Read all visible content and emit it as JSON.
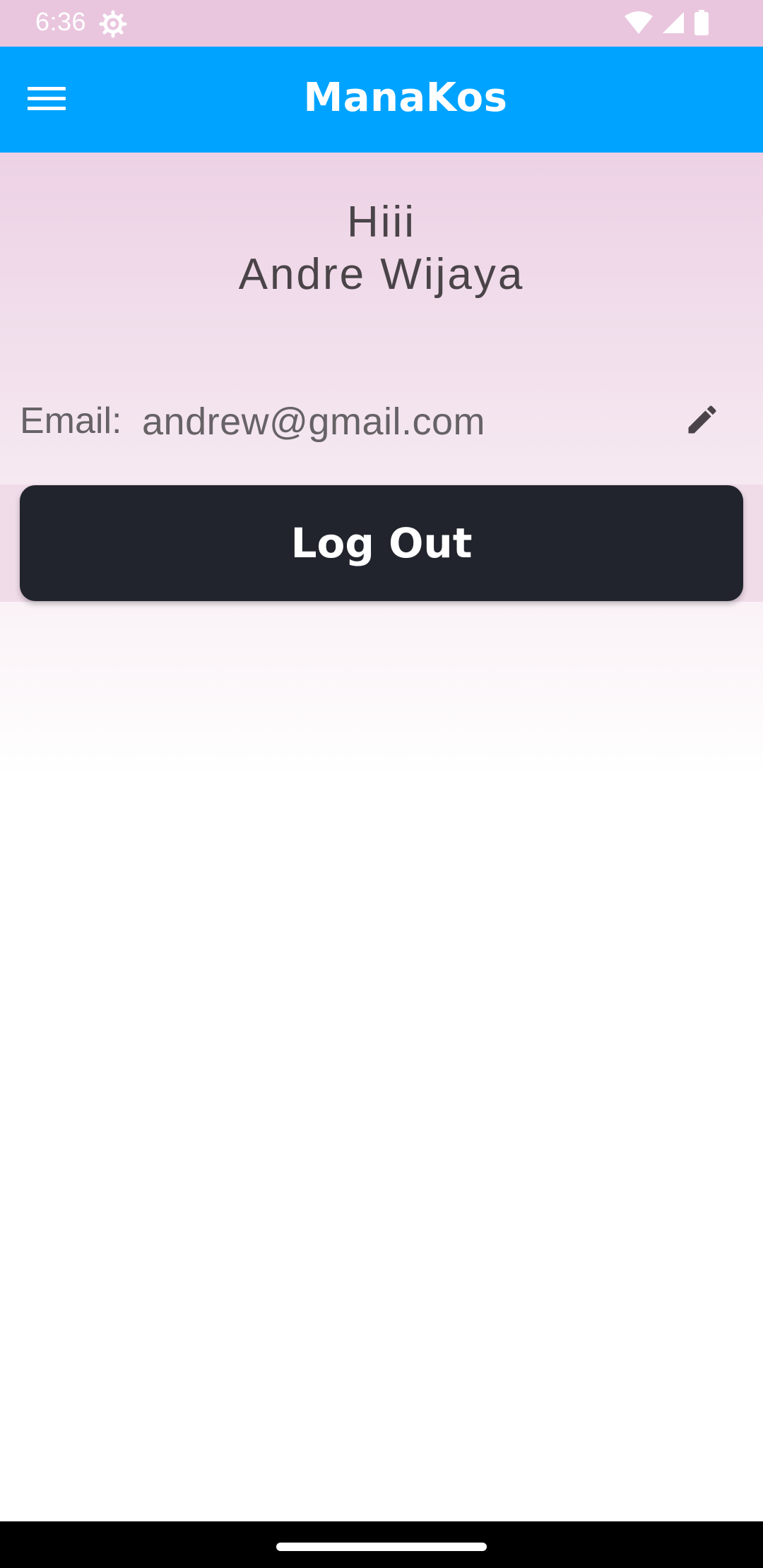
{
  "status_bar": {
    "time": "6:36",
    "icons": [
      "settings-gear-icon",
      "wifi-icon",
      "cell-signal-icon",
      "battery-icon"
    ]
  },
  "app_bar": {
    "title": "ManaKos",
    "menu_icon": "menu-icon",
    "background_color": "#00a3ff"
  },
  "profile": {
    "greeting": "Hiii",
    "name": "Andre Wijaya",
    "email_label": "Email:",
    "email_value": "andrew@gmail.com",
    "edit_icon": "pencil-icon"
  },
  "actions": {
    "logout_label": "Log Out",
    "logout_color": "#21242c"
  }
}
